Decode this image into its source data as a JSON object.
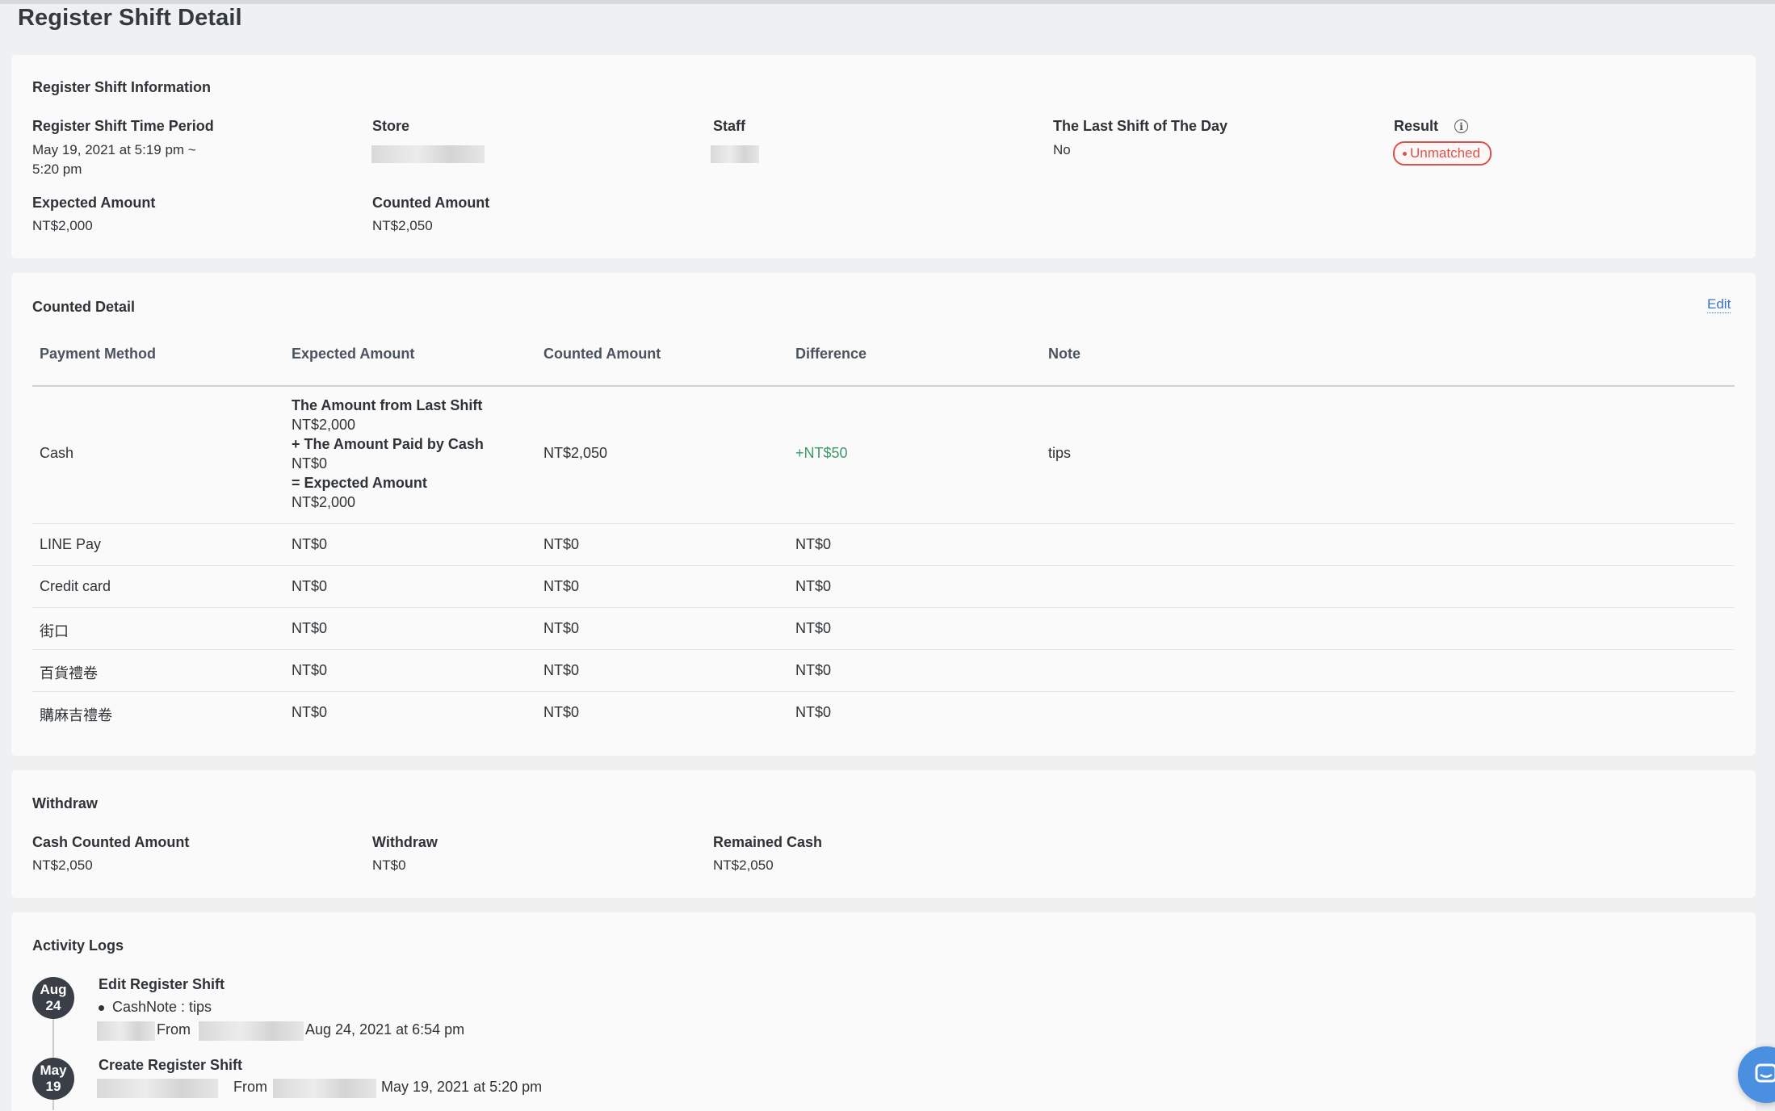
{
  "page": {
    "title": "Register Shift Detail"
  },
  "info": {
    "title": "Register Shift Information",
    "time_period_label": "Register Shift Time Period",
    "time_period_value_line1": "May 19, 2021 at 5:19 pm ~",
    "time_period_value_line2": "5:20 pm",
    "store_label": "Store",
    "staff_label": "Staff",
    "last_shift_label": "The Last Shift of The Day",
    "last_shift_value": "No",
    "result_label": "Result",
    "result_value": "Unmatched",
    "expected_label": "Expected Amount",
    "expected_value": "NT$2,000",
    "counted_label": "Counted Amount",
    "counted_value": "NT$2,050"
  },
  "counted_detail": {
    "title": "Counted Detail",
    "edit_label": "Edit",
    "columns": [
      "Payment Method",
      "Expected Amount",
      "Counted Amount",
      "Difference",
      "Note"
    ],
    "cash": {
      "method": "Cash",
      "breakdown": {
        "last_shift_label": "The Amount from Last Shift",
        "last_shift_value": "NT$2,000",
        "paid_cash_label": "+ The Amount Paid by Cash",
        "paid_cash_value": "NT$0",
        "expected_label": "= Expected Amount",
        "expected_value": "NT$2,000"
      },
      "counted": "NT$2,050",
      "difference": "+NT$50",
      "note": "tips"
    },
    "rows": [
      {
        "method": "LINE Pay",
        "expected": "NT$0",
        "counted": "NT$0",
        "difference": "NT$0"
      },
      {
        "method": "Credit card",
        "expected": "NT$0",
        "counted": "NT$0",
        "difference": "NT$0"
      },
      {
        "method": "街口",
        "expected": "NT$0",
        "counted": "NT$0",
        "difference": "NT$0"
      },
      {
        "method": "百貨禮卷",
        "expected": "NT$0",
        "counted": "NT$0",
        "difference": "NT$0"
      },
      {
        "method": "購麻吉禮卷",
        "expected": "NT$0",
        "counted": "NT$0",
        "difference": "NT$0"
      }
    ]
  },
  "withdraw": {
    "title": "Withdraw",
    "cash_counted_label": "Cash Counted Amount",
    "cash_counted_value": "NT$2,050",
    "withdraw_label": "Withdraw",
    "withdraw_value": "NT$0",
    "remained_label": "Remained Cash",
    "remained_value": "NT$2,050"
  },
  "activity": {
    "title": "Activity Logs",
    "logs": [
      {
        "month": "Aug",
        "day": "24",
        "title": "Edit Register Shift",
        "detail": "CashNote : tips",
        "from_label": "From",
        "timestamp": "Aug 24, 2021 at 6:54 pm"
      },
      {
        "month": "May",
        "day": "19",
        "title": "Create Register Shift",
        "from_label": "From",
        "timestamp": "May 19, 2021 at 5:20 pm"
      }
    ]
  }
}
